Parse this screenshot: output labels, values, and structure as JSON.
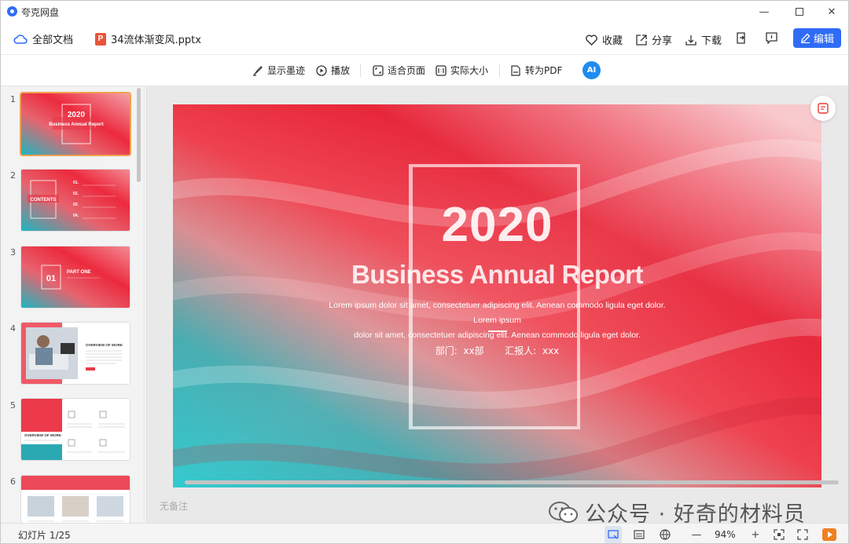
{
  "app": {
    "title": "夸克网盘",
    "controls": [
      "minimize-icon",
      "maximize-icon",
      "close-icon"
    ]
  },
  "header": {
    "all_docs": "全部文档",
    "file_name": "34流体渐变风.pptx",
    "file_icon_letter": "P",
    "favorite": "收藏",
    "share": "分享",
    "download": "下载",
    "edit": "编辑"
  },
  "toolbar": {
    "show_ink": "显示墨迹",
    "play": "播放",
    "fit_page": "适合页面",
    "actual_size": "实际大小",
    "to_pdf": "转为PDF",
    "ai": "AI"
  },
  "thumbnails": [
    {
      "num": "1",
      "selected": true
    },
    {
      "num": "2",
      "selected": false
    },
    {
      "num": "3",
      "selected": false
    },
    {
      "num": "4",
      "selected": false
    },
    {
      "num": "5",
      "selected": false
    },
    {
      "num": "6",
      "selected": false
    }
  ],
  "slide": {
    "year": "2020",
    "title": "Business Annual Report",
    "lorem_line1": "Lorem ipsum dolor sit amet, consectetuer adipiscing elit. Aenean commodo ligula eget dolor. Lorem ipsum",
    "lorem_line2": "dolor sit amet, consectetuer adipiscing elit. Aenean commodo ligula eget dolor.",
    "meta": "部门:  xx部       汇报人:  xxx"
  },
  "notes_placeholder": "无备注",
  "watermark": "公众号 · 好奇的材料员",
  "status": {
    "slide_counter": "幻灯片 1/25",
    "zoom": "94%"
  },
  "colors": {
    "accent": "#2f6cf6",
    "slide_red": "#e8234a",
    "slide_teal": "#1aa6b0",
    "selected_thumb": "#f0a050"
  }
}
